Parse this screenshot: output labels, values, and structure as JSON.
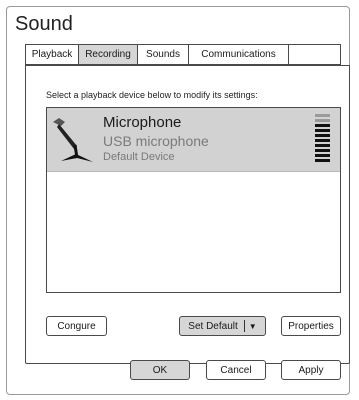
{
  "window": {
    "title": "Sound"
  },
  "tabs": [
    {
      "label": "Playback"
    },
    {
      "label": "Recording"
    },
    {
      "label": "Sounds"
    },
    {
      "label": "Communications"
    }
  ],
  "active_tab": "Recording",
  "instruction": "Select a playback device below to modify its settings:",
  "device": {
    "name": "Microphone",
    "description": "USB microphone",
    "status": "Default Device",
    "icon": "microphone-icon",
    "level_meter": {
      "segments": 10,
      "lit": 8
    }
  },
  "buttons": {
    "configure": "Congure",
    "set_default": "Set Default",
    "set_default_arrow": "▼",
    "properties": "Properties",
    "ok": "OK",
    "cancel": "Cancel",
    "apply": "Apply"
  },
  "colors": {
    "selected_row": "#d2d2d2",
    "meter_lit": "#111111",
    "meter_dim": "#9a9a9a"
  }
}
